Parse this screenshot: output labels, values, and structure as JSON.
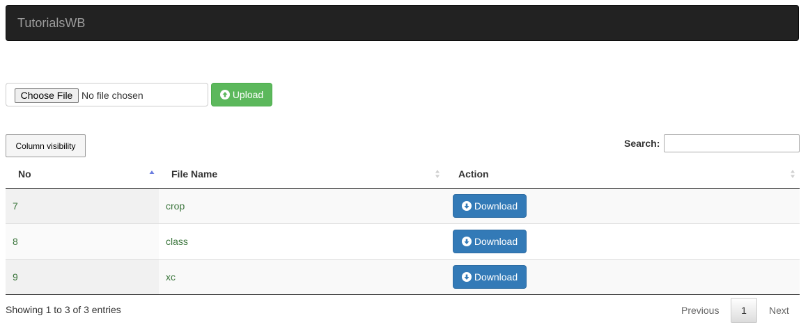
{
  "navbar": {
    "brand": "TutorialsWB"
  },
  "upload": {
    "choose_label": "Choose File",
    "file_status": "No file chosen",
    "upload_label": "Upload"
  },
  "toolbar": {
    "column_visibility_label": "Column visibility",
    "search_label": "Search:",
    "search_value": ""
  },
  "table": {
    "columns": [
      "No",
      "File Name",
      "Action"
    ],
    "sorted_column": "No",
    "rows": [
      {
        "no": "7",
        "file_name": "crop",
        "action": "Download"
      },
      {
        "no": "8",
        "file_name": "class",
        "action": "Download"
      },
      {
        "no": "9",
        "file_name": "xc",
        "action": "Download"
      }
    ]
  },
  "footer": {
    "info": "Showing 1 to 3 of 3 entries",
    "previous": "Previous",
    "current_page": "1",
    "next": "Next"
  },
  "colors": {
    "navbar_bg": "#222222",
    "upload_green": "#5cb85c",
    "download_blue": "#337ab7",
    "cell_text_green": "#3c763d"
  }
}
